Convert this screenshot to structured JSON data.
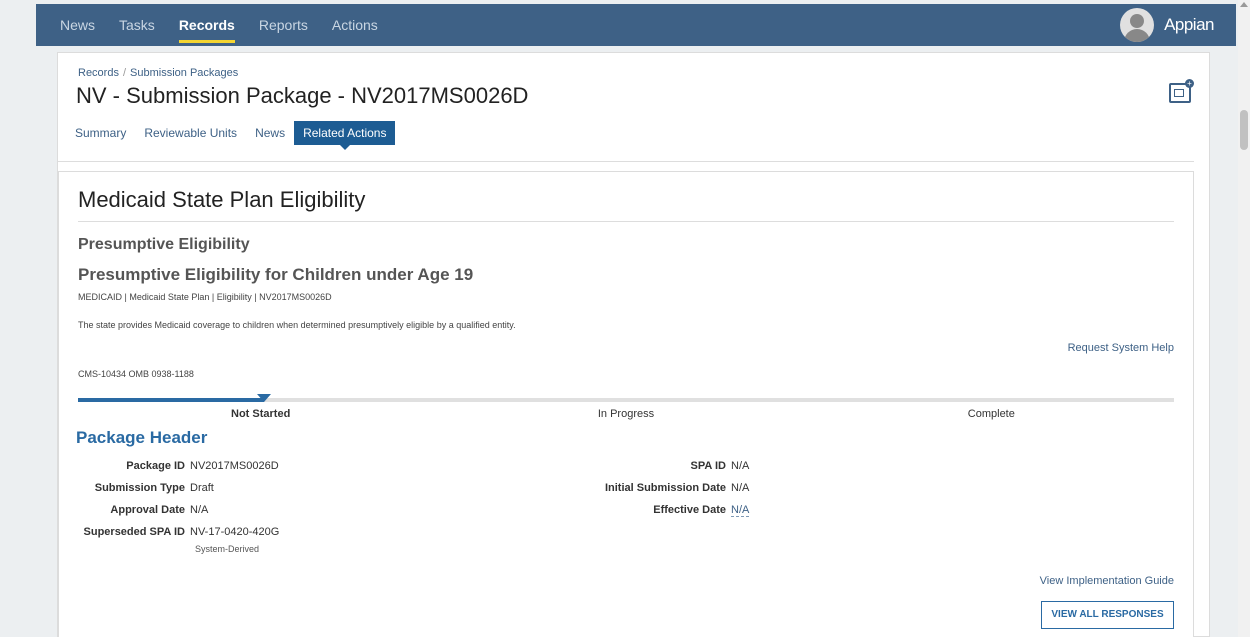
{
  "topnav": {
    "tabs": [
      {
        "label": "News"
      },
      {
        "label": "Tasks"
      },
      {
        "label": "Records"
      },
      {
        "label": "Reports"
      },
      {
        "label": "Actions"
      }
    ],
    "active_tab": "Records",
    "brand": "Appian"
  },
  "breadcrumb": {
    "root": "Records",
    "separator": "/",
    "current": "Submission Packages"
  },
  "page_title": "NV - Submission Package - NV2017MS0026D",
  "record_tabs": [
    {
      "label": "Summary"
    },
    {
      "label": "Reviewable Units"
    },
    {
      "label": "News"
    },
    {
      "label": "Related Actions"
    }
  ],
  "active_record_tab": "Related Actions",
  "card": {
    "title": "Medicaid State Plan Eligibility",
    "section": "Presumptive Eligibility",
    "subtitle": "Presumptive Eligibility for Children under Age 19",
    "meta": "MEDICAID | Medicaid State Plan | Eligibility | NV2017MS0026D",
    "description": "The state provides Medicaid coverage to children when determined presumptively eligible by a qualified entity.",
    "help_link": "Request System Help",
    "omb": "CMS-10434 OMB 0938-1188"
  },
  "progress": {
    "steps": [
      "Not Started",
      "In Progress",
      "Complete"
    ],
    "current_step": "Not Started",
    "fill_fraction": 0.17
  },
  "package_header": {
    "title": "Package Header",
    "left_fields": [
      {
        "label": "Package ID",
        "value": "NV2017MS0026D"
      },
      {
        "label": "Submission Type",
        "value": "Draft"
      },
      {
        "label": "Approval Date",
        "value": "N/A"
      },
      {
        "label": "Superseded SPA ID",
        "value": "NV-17-0420-420G"
      }
    ],
    "superseded_note": "System-Derived",
    "right_fields": [
      {
        "label": "SPA ID",
        "value": "N/A"
      },
      {
        "label": "Initial Submission Date",
        "value": "N/A"
      },
      {
        "label": "Effective Date",
        "value": "N/A"
      }
    ]
  },
  "links": {
    "implementation_guide": "View Implementation Guide",
    "view_all": "VIEW ALL RESPONSES"
  },
  "colors": {
    "nav_bg": "#3e6186",
    "active_underline": "#f3d431",
    "accent": "#2a6aa3",
    "active_tab_bg": "#1d5c93"
  }
}
